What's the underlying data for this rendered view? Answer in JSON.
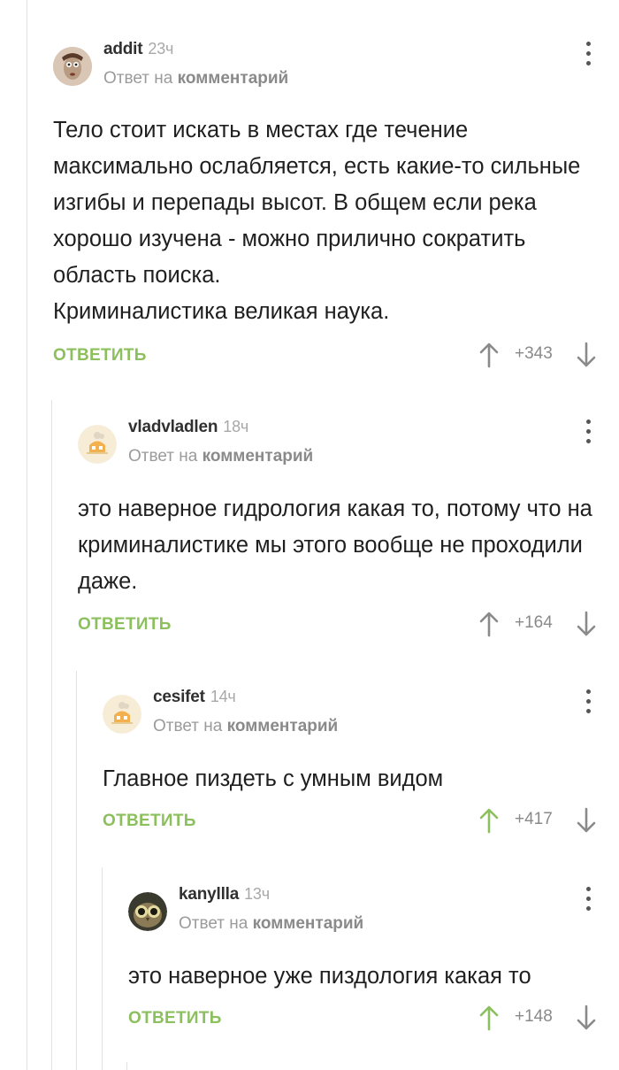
{
  "comments": [
    {
      "username": "addit",
      "time": "23ч",
      "reply_prefix": "Ответ на",
      "reply_target": "комментарий",
      "text": "Тело стоит искать в местах где течение максимально ослабляется, есть какие-то сильные изгибы и перепады высот. В общем если река хорошо изучена - можно прилично сократить область поиска.\nКриминалистика великая наука.",
      "reply_label": "ОТВЕТИТЬ",
      "rating": "+343",
      "upvoted": false
    },
    {
      "username": "vladvladlen",
      "time": "18ч",
      "reply_prefix": "Ответ на",
      "reply_target": "комментарий",
      "text": "это наверное гидрология какая то, потому что на криминалистике мы этого вообще не проходили даже.",
      "reply_label": "ОТВЕТИТЬ",
      "rating": "+164",
      "upvoted": false
    },
    {
      "username": "cesifet",
      "time": "14ч",
      "reply_prefix": "Ответ на",
      "reply_target": "комментарий",
      "text": "Главное пиздеть с умным видом",
      "reply_label": "ОТВЕТИТЬ",
      "rating": "+417",
      "upvoted": true
    },
    {
      "username": "kanyllla",
      "time": "13ч",
      "reply_prefix": "Ответ на",
      "reply_target": "комментарий",
      "text": "это наверное уже пиздология какая то",
      "reply_label": "ОТВЕТИТЬ",
      "rating": "+148",
      "upvoted": true
    }
  ],
  "colors": {
    "accent_green": "#8cbf5d",
    "arrow_gray": "#8a8a8a",
    "thread_line": "#e2e2e2"
  },
  "icons": {
    "up": "arrow-up-icon",
    "down": "arrow-down-icon",
    "more": "more-vertical-icon"
  }
}
